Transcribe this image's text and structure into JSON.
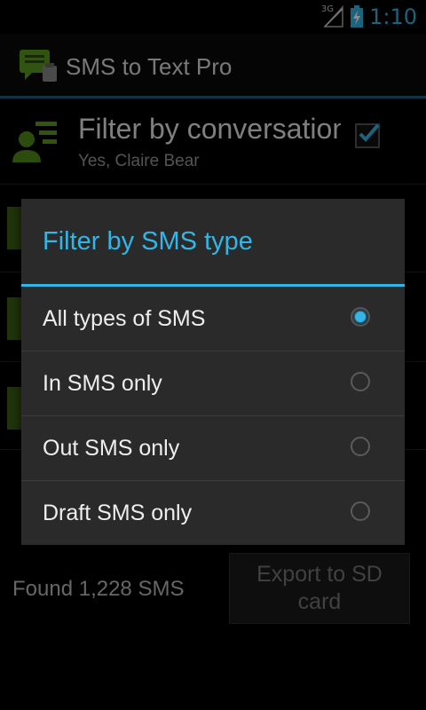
{
  "status_bar": {
    "network": "3G",
    "time": "1:10",
    "icons": [
      "signal-icon",
      "battery-charging-icon"
    ]
  },
  "action_bar": {
    "title": "SMS to Text Pro",
    "icon": "sms-app-icon"
  },
  "preferences": [
    {
      "title": "Filter by conversation",
      "summary": "Yes, Claire Bear",
      "icon": "contact-filter-icon",
      "checked": true
    }
  ],
  "footer": {
    "found_text": "Found 1,228 SMS",
    "export_button": "Export to SD card"
  },
  "dialog": {
    "title": "Filter by SMS type",
    "options": [
      {
        "label": "All types of SMS",
        "selected": true
      },
      {
        "label": "In SMS only",
        "selected": false
      },
      {
        "label": "Out SMS only",
        "selected": false
      },
      {
        "label": "Draft SMS only",
        "selected": false
      }
    ]
  },
  "colors": {
    "accent": "#33b5e5",
    "background": "#000000",
    "dialog_background": "#2a2a2a",
    "icon_green": "#5a9a20"
  }
}
